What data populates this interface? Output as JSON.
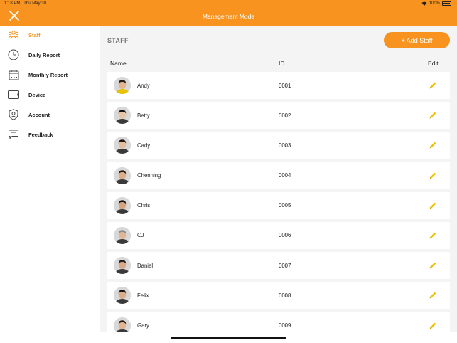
{
  "status_bar": {
    "time": "1:18 PM",
    "date": "Thu May 30",
    "battery": "100%"
  },
  "header": {
    "title": "Management Mode"
  },
  "sidebar": {
    "items": [
      {
        "label": "Staff",
        "icon": "staff-group-icon",
        "active": true
      },
      {
        "label": "Daily Report",
        "icon": "clock-icon",
        "active": false
      },
      {
        "label": "Monthly Report",
        "icon": "calendar-icon",
        "active": false
      },
      {
        "label": "Device",
        "icon": "tablet-icon",
        "active": false
      },
      {
        "label": "Account",
        "icon": "shield-user-icon",
        "active": false
      },
      {
        "label": "Feedback",
        "icon": "chat-bubble-icon",
        "active": false
      }
    ]
  },
  "main": {
    "section_title": "STAFF",
    "add_button": "+ Add Staff",
    "columns": {
      "name": "Name",
      "id": "ID",
      "edit": "Edit"
    },
    "staff": [
      {
        "name": "Andy",
        "id": "0001"
      },
      {
        "name": "Betty",
        "id": "0002"
      },
      {
        "name": "Cady",
        "id": "0003"
      },
      {
        "name": "Chenning",
        "id": "0004"
      },
      {
        "name": "Chris",
        "id": "0005"
      },
      {
        "name": "CJ",
        "id": "0006"
      },
      {
        "name": "Daniel",
        "id": "0007"
      },
      {
        "name": "Felix",
        "id": "0008"
      },
      {
        "name": "Gary",
        "id": "0009"
      }
    ]
  },
  "colors": {
    "accent": "#f7931e",
    "edit_icon": "#f2c200",
    "background": "#f4f4f4"
  }
}
